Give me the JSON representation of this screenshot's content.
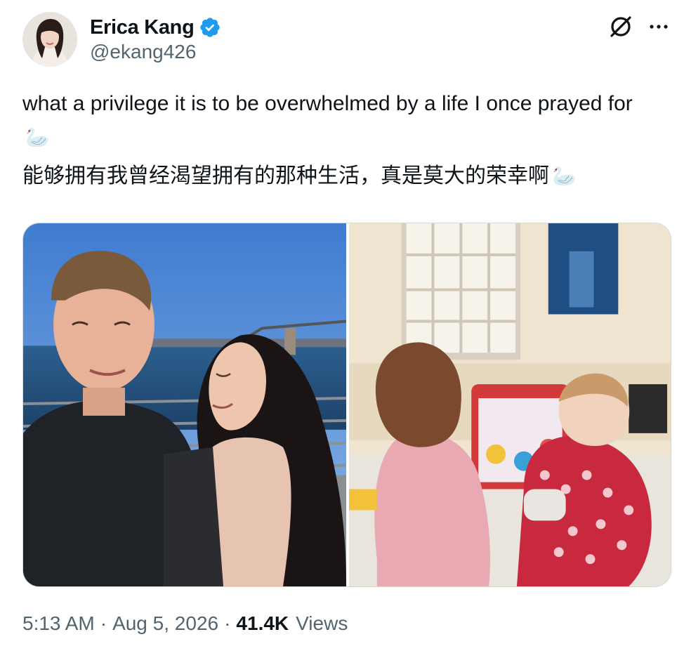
{
  "author": {
    "display_name": "Erica Kang",
    "handle": "@ekang426",
    "verified": true,
    "verified_color": "#1d9bf0"
  },
  "header_icons": {
    "grok": "grok-icon",
    "more": "more-icon"
  },
  "tweet": {
    "text_en": "what a privilege it is to be overwhelmed by a life I once prayed for",
    "text_zh": "能够拥有我曾经渴望拥有的那种生活，真是莫大的荣幸啊",
    "emoji": "🦢"
  },
  "media": [
    {
      "name": "selfie-photo",
      "icon": "photo"
    },
    {
      "name": "children-playroom-photo",
      "icon": "photo"
    }
  ],
  "meta": {
    "time": "5:13 AM",
    "separator": "·",
    "date": "Aug 5, 2026",
    "views_count": "41.4K",
    "views_label": "Views"
  }
}
